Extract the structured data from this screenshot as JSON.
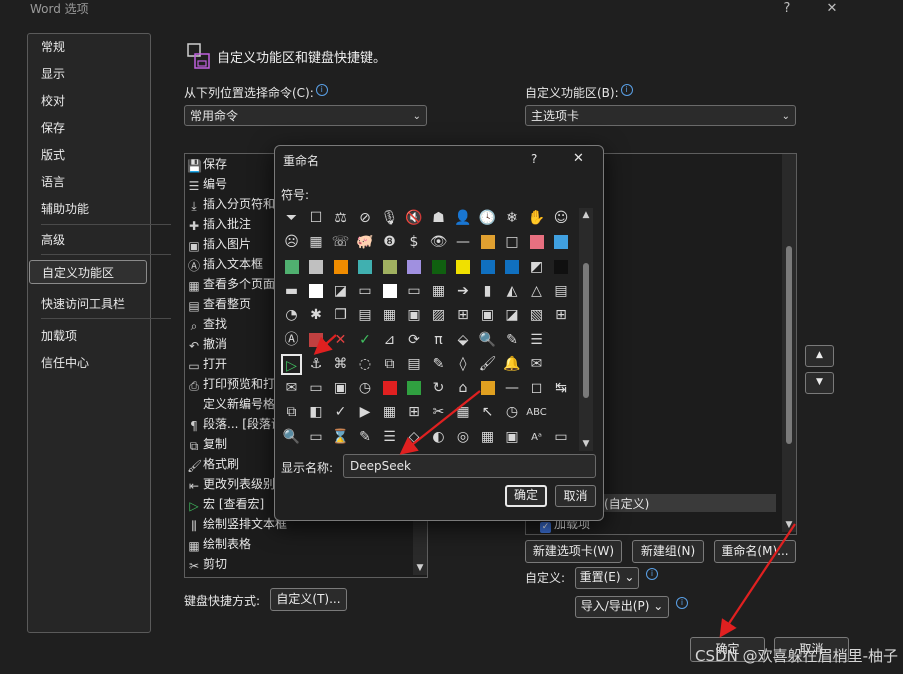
{
  "window": {
    "title": "Word 选项",
    "help": "?",
    "close": "✕"
  },
  "nav": {
    "items": [
      {
        "label": "常规"
      },
      {
        "label": "显示"
      },
      {
        "label": "校对"
      },
      {
        "label": "保存"
      },
      {
        "label": "版式"
      },
      {
        "label": "语言"
      },
      {
        "label": "辅助功能"
      },
      {
        "label": "高级"
      },
      {
        "label": "自定义功能区"
      },
      {
        "label": "快速访问工具栏"
      },
      {
        "label": "加载项"
      },
      {
        "label": "信任中心"
      }
    ],
    "selected": "自定义功能区"
  },
  "header": {
    "text": "自定义功能区和键盘快捷键。"
  },
  "left": {
    "choose_label": "从下列位置选择命令(C):",
    "choose_value": "常用命令",
    "commands": [
      {
        "icon": "save-icon",
        "label": "保存"
      },
      {
        "icon": "numbering-icon",
        "label": "编号"
      },
      {
        "icon": "page-break-icon",
        "label": "插入分页符和"
      },
      {
        "icon": "comment-icon",
        "label": "插入批注"
      },
      {
        "icon": "picture-icon",
        "label": "插入图片"
      },
      {
        "icon": "textbox-icon",
        "label": "插入文本框"
      },
      {
        "icon": "multi-page-icon",
        "label": "查看多个页面"
      },
      {
        "icon": "whole-page-icon",
        "label": "查看整页"
      },
      {
        "icon": "find-icon",
        "label": "查找"
      },
      {
        "icon": "undo-icon",
        "label": "撤消"
      },
      {
        "icon": "open-icon",
        "label": "打开"
      },
      {
        "icon": "print-preview-icon",
        "label": "打印预览和打"
      },
      {
        "icon": "",
        "label": "定义新编号格"
      },
      {
        "icon": "paragraph-icon",
        "label": "段落... [段落设"
      },
      {
        "icon": "copy-icon",
        "label": "复制"
      },
      {
        "icon": "format-painter-icon",
        "label": "格式刷"
      },
      {
        "icon": "list-level-icon",
        "label": "更改列表级别"
      },
      {
        "icon": "macro-icon",
        "label": "宏 [查看宏]"
      },
      {
        "icon": "vertical-textbox-icon",
        "label": "绘制竖排文本框"
      },
      {
        "icon": "draw-table-icon",
        "label": "绘制表格"
      },
      {
        "icon": "cut-icon",
        "label": "剪切"
      }
    ],
    "shortcut_label": "键盘快捷方式:",
    "shortcut_button": "自定义(T)..."
  },
  "right": {
    "ribbon_label": "自定义功能区(B):",
    "ribbon_value": "主选项卡",
    "partial_items": [
      {
        "label": "(自定义)"
      },
      {
        "label": "加载项"
      }
    ],
    "buttons": {
      "new_tab": "新建选项卡(W)",
      "new_group": "新建组(N)",
      "rename": "重命名(M)..."
    },
    "customize_label": "自定义:",
    "reset": "重置(E)",
    "import_export": "导入/导出(P)"
  },
  "footer": {
    "ok": "确定",
    "cancel": "取消"
  },
  "dialog": {
    "title": "重命名",
    "help": "?",
    "close": "✕",
    "symbol_label": "符号:",
    "display_name_label": "显示名称:",
    "display_name_value": "DeepSeek",
    "ok": "确定",
    "cancel": "取消"
  },
  "symbols": [
    [
      "⏷",
      "☐",
      "⚖",
      "⊘",
      "🎙",
      "🔇",
      "☗",
      "👤",
      "🕓",
      "❄",
      "✋",
      "☺"
    ],
    [
      "☹",
      "▦",
      "☏",
      "🐖",
      "❽",
      "$",
      "👁",
      "—",
      "#e0a030",
      "□",
      "#e87080",
      "#40a0e0"
    ],
    [
      "#50b070",
      "#c0c0c0",
      "#f08c00",
      "#40b0b0",
      "#a0b060",
      "#a090e0",
      "#106010",
      "#f0e000",
      "#1070c0",
      "#1070c0",
      "◩",
      "#101010"
    ],
    [
      "▬",
      "#ffffff",
      "◪",
      "▭",
      "#ffffff",
      "▭",
      "▦",
      "➔",
      "▮",
      "◭",
      "△",
      "▤"
    ],
    [
      "◔",
      "✱",
      "❐",
      "▤",
      "▦",
      "▣",
      "▨",
      "⊞",
      "▣",
      "◪",
      "▧",
      "⊞"
    ],
    [
      "Ⓐ",
      "#c04040",
      "✕",
      "✓",
      "⊿",
      "⟳",
      "π",
      "⬙",
      "🔍",
      "✎",
      "☰"
    ],
    [
      "▷",
      "⚓",
      "⌘",
      "◌",
      "⧉",
      "▤",
      "✎",
      "◊",
      "🖌",
      "🔔",
      "✉"
    ],
    [
      "✉",
      "▭",
      "▣",
      "◷",
      "#e02020",
      "#30a040",
      "↻",
      "⌂",
      "#e0a020",
      "—",
      "◻",
      "↹"
    ],
    [
      "⧉",
      "◧",
      "✓",
      "▶",
      "▦",
      "⊞",
      "✂",
      "▦",
      "↖",
      "◷",
      "ABC"
    ],
    [
      "🔍",
      "▭",
      "⌛",
      "✎",
      "☰",
      "◇",
      "◐",
      "◎",
      "▦",
      "▣",
      "Aᵃ",
      "▭"
    ]
  ],
  "watermark": "CSDN @欢喜躲在眉梢里-柚子"
}
